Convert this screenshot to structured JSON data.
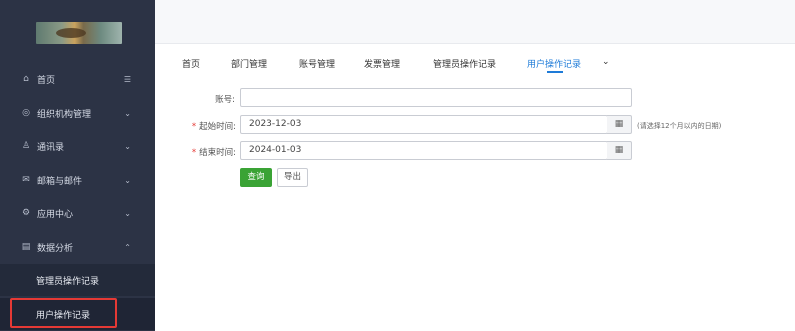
{
  "sidebar": {
    "items": [
      {
        "label": "首页",
        "icon": "home-icon",
        "arrow": "☰"
      },
      {
        "label": "组织机构管理",
        "icon": "org-icon",
        "arrow": "⌄"
      },
      {
        "label": "通讯录",
        "icon": "contacts-icon",
        "arrow": "⌄"
      },
      {
        "label": "邮箱与邮件",
        "icon": "mail-icon",
        "arrow": "⌄"
      },
      {
        "label": "应用中心",
        "icon": "apps-icon",
        "arrow": "⌄"
      },
      {
        "label": "数据分析",
        "icon": "chart-icon",
        "arrow": "⌃"
      }
    ],
    "sub_items": [
      {
        "label": "管理员操作记录"
      },
      {
        "label": "用户操作记录"
      }
    ]
  },
  "tabs": [
    {
      "label": "首页"
    },
    {
      "label": "部门管理"
    },
    {
      "label": "账号管理"
    },
    {
      "label": "发票管理"
    },
    {
      "label": "管理员操作记录"
    },
    {
      "label": "用户操作记录"
    },
    {
      "label": "⌄"
    }
  ],
  "form": {
    "account_label": "账号:",
    "account_value": "",
    "start_label": "起始时间:",
    "start_value": "2023-12-03",
    "end_label": "结束时间:",
    "end_value": "2024-01-03",
    "required_mark": "*",
    "hint": "(请选择12个月以内的日期)",
    "query_button": "查询",
    "export_button": "导出"
  },
  "colors": {
    "sidebar_bg": "#2c3345",
    "accent": "#1e7bd8",
    "query_btn": "#3aa335",
    "highlight": "#e53935"
  }
}
